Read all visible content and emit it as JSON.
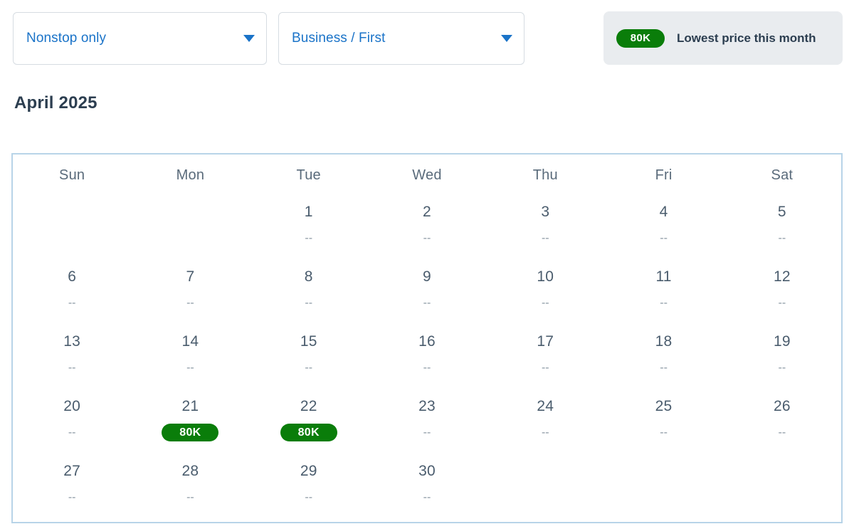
{
  "filters": [
    {
      "name": "stops-filter",
      "value": "Nonstop only",
      "icon": "chevron-down-icon"
    },
    {
      "name": "cabin-filter",
      "value": "Business / First",
      "icon": "chevron-down-icon"
    }
  ],
  "legend": {
    "badge": "80K",
    "text": "Lowest price this month",
    "badge_color": "#0a7d0a",
    "panel_color": "#e9ecef"
  },
  "calendar": {
    "month_title": "April 2025",
    "weekdays": [
      "Sun",
      "Mon",
      "Tue",
      "Wed",
      "Thu",
      "Fri",
      "Sat"
    ],
    "no_price_marker": "--",
    "weeks": [
      [
        {
          "day": "",
          "price": "",
          "lowest": false,
          "empty": true
        },
        {
          "day": "",
          "price": "",
          "lowest": false,
          "empty": true
        },
        {
          "day": "1",
          "price": "--",
          "lowest": false,
          "empty": false
        },
        {
          "day": "2",
          "price": "--",
          "lowest": false,
          "empty": false
        },
        {
          "day": "3",
          "price": "--",
          "lowest": false,
          "empty": false
        },
        {
          "day": "4",
          "price": "--",
          "lowest": false,
          "empty": false
        },
        {
          "day": "5",
          "price": "--",
          "lowest": false,
          "empty": false
        }
      ],
      [
        {
          "day": "6",
          "price": "--",
          "lowest": false,
          "empty": false
        },
        {
          "day": "7",
          "price": "--",
          "lowest": false,
          "empty": false
        },
        {
          "day": "8",
          "price": "--",
          "lowest": false,
          "empty": false
        },
        {
          "day": "9",
          "price": "--",
          "lowest": false,
          "empty": false
        },
        {
          "day": "10",
          "price": "--",
          "lowest": false,
          "empty": false
        },
        {
          "day": "11",
          "price": "--",
          "lowest": false,
          "empty": false
        },
        {
          "day": "12",
          "price": "--",
          "lowest": false,
          "empty": false
        }
      ],
      [
        {
          "day": "13",
          "price": "--",
          "lowest": false,
          "empty": false
        },
        {
          "day": "14",
          "price": "--",
          "lowest": false,
          "empty": false
        },
        {
          "day": "15",
          "price": "--",
          "lowest": false,
          "empty": false
        },
        {
          "day": "16",
          "price": "--",
          "lowest": false,
          "empty": false
        },
        {
          "day": "17",
          "price": "--",
          "lowest": false,
          "empty": false
        },
        {
          "day": "18",
          "price": "--",
          "lowest": false,
          "empty": false
        },
        {
          "day": "19",
          "price": "--",
          "lowest": false,
          "empty": false
        }
      ],
      [
        {
          "day": "20",
          "price": "--",
          "lowest": false,
          "empty": false
        },
        {
          "day": "21",
          "price": "80K",
          "lowest": true,
          "empty": false
        },
        {
          "day": "22",
          "price": "80K",
          "lowest": true,
          "empty": false
        },
        {
          "day": "23",
          "price": "--",
          "lowest": false,
          "empty": false
        },
        {
          "day": "24",
          "price": "--",
          "lowest": false,
          "empty": false
        },
        {
          "day": "25",
          "price": "--",
          "lowest": false,
          "empty": false
        },
        {
          "day": "26",
          "price": "--",
          "lowest": false,
          "empty": false
        }
      ],
      [
        {
          "day": "27",
          "price": "--",
          "lowest": false,
          "empty": false
        },
        {
          "day": "28",
          "price": "--",
          "lowest": false,
          "empty": false
        },
        {
          "day": "29",
          "price": "--",
          "lowest": false,
          "empty": false
        },
        {
          "day": "30",
          "price": "--",
          "lowest": false,
          "empty": false
        },
        {
          "day": "",
          "price": "",
          "lowest": false,
          "empty": true
        },
        {
          "day": "",
          "price": "",
          "lowest": false,
          "empty": true
        },
        {
          "day": "",
          "price": "",
          "lowest": false,
          "empty": true
        }
      ]
    ]
  }
}
